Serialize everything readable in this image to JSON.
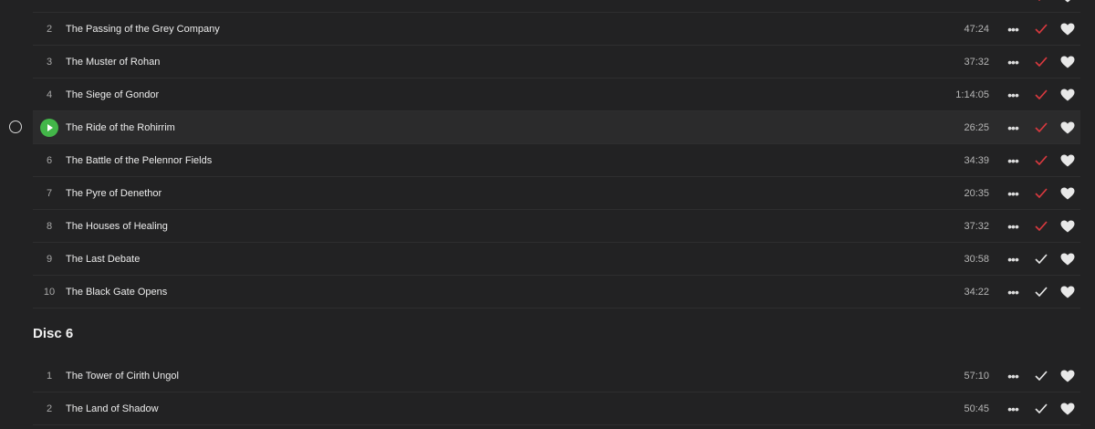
{
  "colors": {
    "background": "#222223",
    "row_border": "#2e2e2f",
    "playing_row": "#2b2b2c",
    "play_green": "#43b649",
    "check_red": "#d9393f",
    "check_white": "#e6e6e6",
    "heart": "#e8e8e8"
  },
  "icons": {
    "more": "more-dots-icon",
    "check": "check-icon",
    "heart": "heart-icon",
    "play": "play-icon",
    "radio": "radio-circle-icon"
  },
  "more_glyph": "•••",
  "disc5": {
    "tracks": [
      {
        "num": "2",
        "title": "The Passing of the Grey Company",
        "duration": "47:24",
        "checked_color": "red"
      },
      {
        "num": "3",
        "title": "The Muster of Rohan",
        "duration": "37:32",
        "checked_color": "red"
      },
      {
        "num": "4",
        "title": "The Siege of Gondor",
        "duration": "1:14:05",
        "checked_color": "red"
      },
      {
        "num": "",
        "title": "The Ride of the Rohirrim",
        "duration": "26:25",
        "checked_color": "red",
        "playing": true
      },
      {
        "num": "6",
        "title": "The Battle of the Pelennor Fields",
        "duration": "34:39",
        "checked_color": "red"
      },
      {
        "num": "7",
        "title": "The Pyre of Denethor",
        "duration": "20:35",
        "checked_color": "red"
      },
      {
        "num": "8",
        "title": "The Houses of Healing",
        "duration": "37:32",
        "checked_color": "red"
      },
      {
        "num": "9",
        "title": "The Last Debate",
        "duration": "30:58",
        "checked_color": "white"
      },
      {
        "num": "10",
        "title": "The Black Gate Opens",
        "duration": "34:22",
        "checked_color": "white"
      }
    ]
  },
  "disc6": {
    "heading": "Disc 6",
    "tracks": [
      {
        "num": "1",
        "title": "The Tower of Cirith Ungol",
        "duration": "57:10",
        "checked_color": "white"
      },
      {
        "num": "2",
        "title": "The Land of Shadow",
        "duration": "50:45",
        "checked_color": "white"
      }
    ]
  }
}
